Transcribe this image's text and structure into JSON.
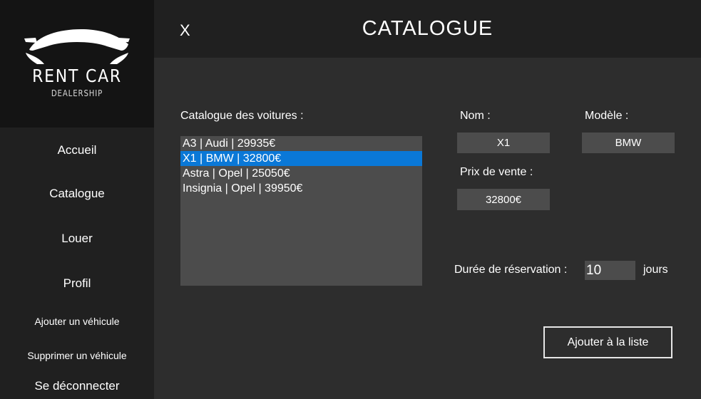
{
  "sidebar": {
    "logo": {
      "title": "RENT CAR",
      "subtitle": "DEALERSHIP"
    },
    "items": [
      {
        "label": "Accueil"
      },
      {
        "label": "Catalogue"
      },
      {
        "label": "Louer"
      },
      {
        "label": "Profil"
      },
      {
        "label": "Ajouter un véhicule"
      },
      {
        "label": "Supprimer un véhicule"
      },
      {
        "label": "Se déconnecter"
      }
    ]
  },
  "header": {
    "close": "X",
    "title": "CATALOGUE"
  },
  "catalogue": {
    "label": "Catalogue des voitures :",
    "items": [
      {
        "text": "A3 | Audi | 29935€"
      },
      {
        "text": "X1 | BMW | 32800€"
      },
      {
        "text": "Astra | Opel | 25050€"
      },
      {
        "text": "Insignia | Opel | 39950€"
      }
    ],
    "selected_index": 1
  },
  "details": {
    "nom_label": "Nom :",
    "nom_value": "X1",
    "modele_label": "Modèle :",
    "modele_value": "BMW",
    "prix_label": "Prix de vente :",
    "prix_value": "32800€"
  },
  "reservation": {
    "label": "Durée de réservation :",
    "value": "10",
    "unit": "jours"
  },
  "actions": {
    "add_label": "Ajouter à la liste"
  },
  "colors": {
    "selection": "#0a78d7",
    "sidebar": "#202020",
    "main": "#2d2d2d",
    "field": "#4c4c4c"
  }
}
